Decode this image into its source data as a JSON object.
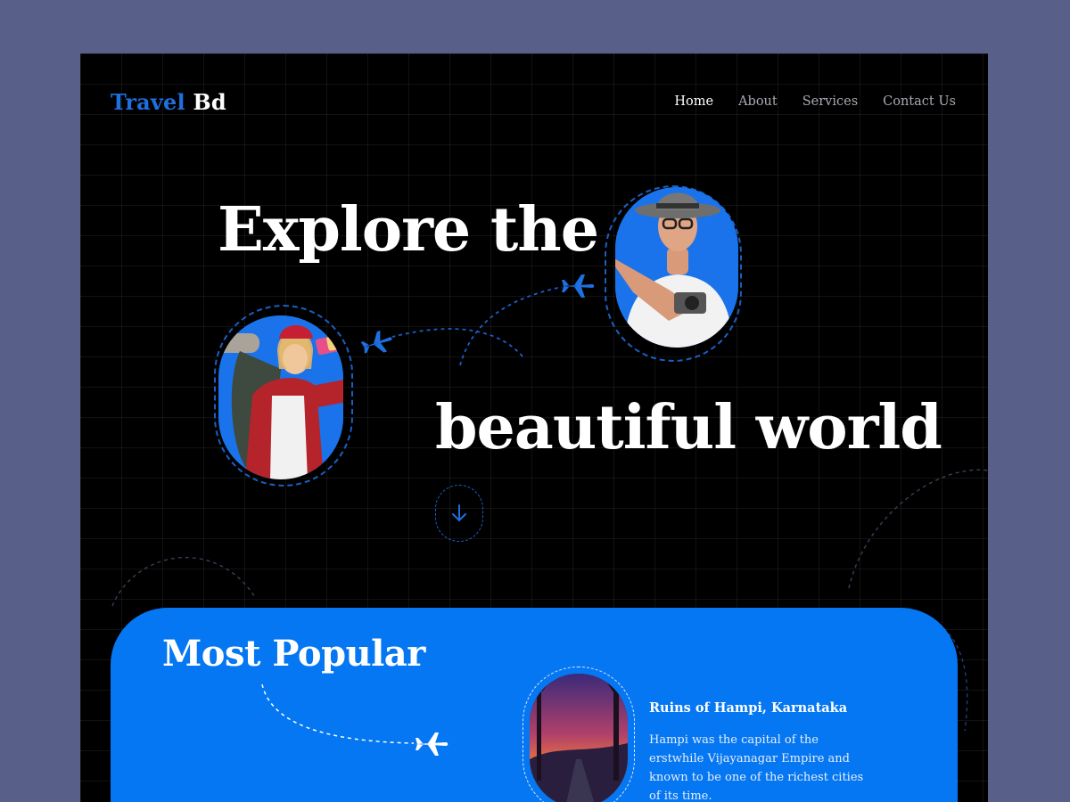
{
  "logo": {
    "part1": "Travel",
    "part2": "Bd"
  },
  "nav": {
    "items": [
      "Home",
      "About",
      "Services",
      "Contact Us"
    ],
    "active_index": 0
  },
  "hero": {
    "line1": "Explore the",
    "line2": "beautiful world"
  },
  "popular": {
    "title": "Most Popular",
    "card": {
      "title": "Ruins of Hampi, Karnataka",
      "description": "Hampi was the capital of the  erstwhile Vijayanagar Empire and known to be one of the richest cities of its time."
    }
  },
  "colors": {
    "accent": "#1a73ea",
    "panel": "#0677f2",
    "background": "#000000",
    "outer": "#586089"
  },
  "icons": [
    "airplane-icon",
    "arrow-down-icon"
  ]
}
